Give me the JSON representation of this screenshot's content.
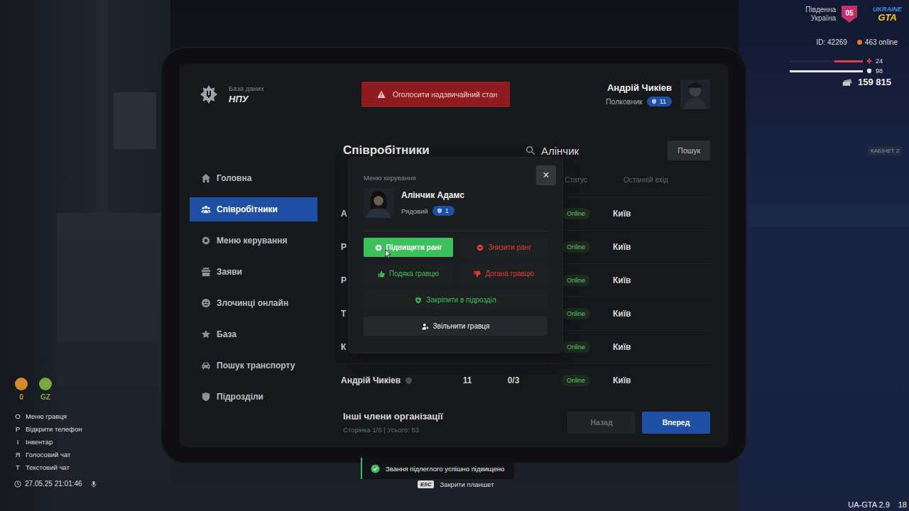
{
  "scene": {
    "wall_sign": "КАБІНЕТ 2"
  },
  "hud": {
    "server": {
      "lines": [
        "Південна",
        "Україна"
      ],
      "badge": "05"
    },
    "logo": {
      "top": "UKRAINE",
      "bottom": "GTA"
    },
    "player_id": "ID: 42269",
    "online": "463 online",
    "stats": [
      {
        "kind": "health",
        "value": "24",
        "level": 0.39,
        "color": "#d9424a"
      },
      {
        "kind": "armor",
        "value": "98",
        "level": 1.0,
        "color": "#e6e6e6"
      }
    ],
    "money": "159 815",
    "indicators": [
      {
        "value": "0",
        "color": "#d08a2c"
      },
      {
        "value": "GZ",
        "color": "#7aa83c"
      }
    ],
    "keybinds": [
      {
        "key": "O",
        "label": "Меню гравця"
      },
      {
        "key": "P",
        "label": "Відкрити телефон"
      },
      {
        "key": "I",
        "label": "Інвентар"
      },
      {
        "key": "Я",
        "label": "Голосовий чат"
      },
      {
        "key": "T",
        "label": "Текстовий чат"
      }
    ],
    "datetime": "27.05.25 21:01:46",
    "version": "UA-GTA 2.9",
    "version_extra": "18"
  },
  "tablet": {
    "brand": {
      "subtitle": "База даних",
      "title": "НПУ"
    },
    "emergency_button": "Оголосити надзвичайний стан",
    "user": {
      "name": "Андрій Чикіев",
      "rank": "Полковник",
      "level": "11"
    },
    "sidebar": [
      {
        "label": "Головна",
        "selected": false
      },
      {
        "label": "Співробітники",
        "selected": true
      },
      {
        "label": "Меню керування",
        "selected": false
      },
      {
        "label": "Заяви",
        "selected": false
      },
      {
        "label": "Злочинці онлайн",
        "selected": false
      },
      {
        "label": "База",
        "selected": false
      },
      {
        "label": "Пошук транспорту",
        "selected": false
      },
      {
        "label": "Підрозділи",
        "selected": false
      }
    ],
    "page_title": "Співробітники",
    "search": {
      "value": "Алінчик",
      "button": "Пошук"
    },
    "table": {
      "columns": [
        "Статус",
        "Останній вхід"
      ],
      "rows": [
        {
          "name": "А",
          "badge": false,
          "status": "Online",
          "city": "Київ"
        },
        {
          "name": "Р",
          "badge": false,
          "status": "Online",
          "city": "Київ"
        },
        {
          "name": "Р",
          "badge": false,
          "status": "Online",
          "city": "Київ"
        },
        {
          "name": "Т",
          "badge": false,
          "status": "Online",
          "city": "Київ"
        },
        {
          "name": "К",
          "badge": false,
          "status": "Online",
          "city": "Київ"
        },
        {
          "name": "Андрій Чикіев",
          "badge": true,
          "rank": "11",
          "warnings": "0/3",
          "status": "Online",
          "city": "Київ"
        }
      ]
    },
    "footer": {
      "title": "Інші члени організації",
      "pagination": "Сторінка 1/6 | Усього: 53",
      "buttons": [
        {
          "label": "Назад",
          "disabled": true
        },
        {
          "label": "Вперед",
          "disabled": false
        }
      ]
    }
  },
  "modal": {
    "title": "Меню керування",
    "close": "×",
    "member": {
      "name": "Алінчик Адамс",
      "rank": "Рядовий",
      "level": "1"
    },
    "actions": [
      {
        "label": "Підвищити ранг",
        "kind": "promote",
        "hovered": true
      },
      {
        "label": "Знизити ранг",
        "kind": "demote",
        "hovered": false
      },
      {
        "label": "Подяка гравцю",
        "kind": "praise",
        "hovered": false
      },
      {
        "label": "Догана гравцю",
        "kind": "reprimand",
        "hovered": false
      },
      {
        "label": "Закріпити в підрозділ",
        "kind": "assign",
        "hovered": false
      },
      {
        "label": "Звільнити гравця",
        "kind": "dismiss",
        "hovered": false
      }
    ]
  },
  "notification": {
    "text": "Звання підлеглого успішно підвищено",
    "hint_key": "ESC",
    "hint": "Закрити планшет"
  }
}
